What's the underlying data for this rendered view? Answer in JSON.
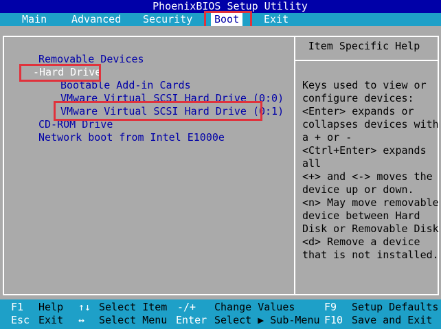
{
  "title": "PhoenixBIOS Setup Utility",
  "menu": {
    "items": [
      "Main",
      "Advanced",
      "Security",
      "Boot",
      "Exit"
    ],
    "active": "Boot"
  },
  "boot_list": {
    "removable": "Removable Devices",
    "hard_drive": "-Hard Drive",
    "bootable_addin": "Bootable Add-in Cards",
    "scsi_0": "VMware Virtual SCSI Hard Drive (0:0)",
    "scsi_1": "VMware Virtual SCSI Hard Drive (0:1)",
    "cdrom": "CD-ROM Drive",
    "network": "Network boot from Intel E1000e"
  },
  "help": {
    "title": "Item Specific Help",
    "lines": [
      "Keys used to view or",
      "configure devices:",
      "<Enter> expands or",
      "collapses devices with",
      "a + or -",
      "<Ctrl+Enter> expands",
      "all",
      "<+> and <-> moves the",
      "device up or down.",
      "<n> May move removable",
      "device between Hard",
      "Disk or Removable Disk",
      "<d> Remove a device",
      "that is not installed."
    ]
  },
  "status": {
    "f1_key": "F1",
    "f1_label": "Help",
    "updown_key": "↑↓",
    "updown_label": "Select Item",
    "plusminus_key": "-/+",
    "plusminus_label": "Change Values",
    "f9_key": "F9",
    "f9_label": "Setup Defaults",
    "esc_key": "Esc",
    "esc_label": "Exit",
    "leftright_key": "↔",
    "leftright_label": "Select Menu",
    "enter_key": "Enter",
    "enter_label": "Select ▶ Sub-Menu",
    "f10_key": "F10",
    "f10_label": "Save and Exit"
  },
  "colors": {
    "bios_blue": "#0000a8",
    "menu_cyan": "#1ea0c8",
    "panel_gray": "#aaaaaa",
    "annotation_red": "#e0323c"
  }
}
